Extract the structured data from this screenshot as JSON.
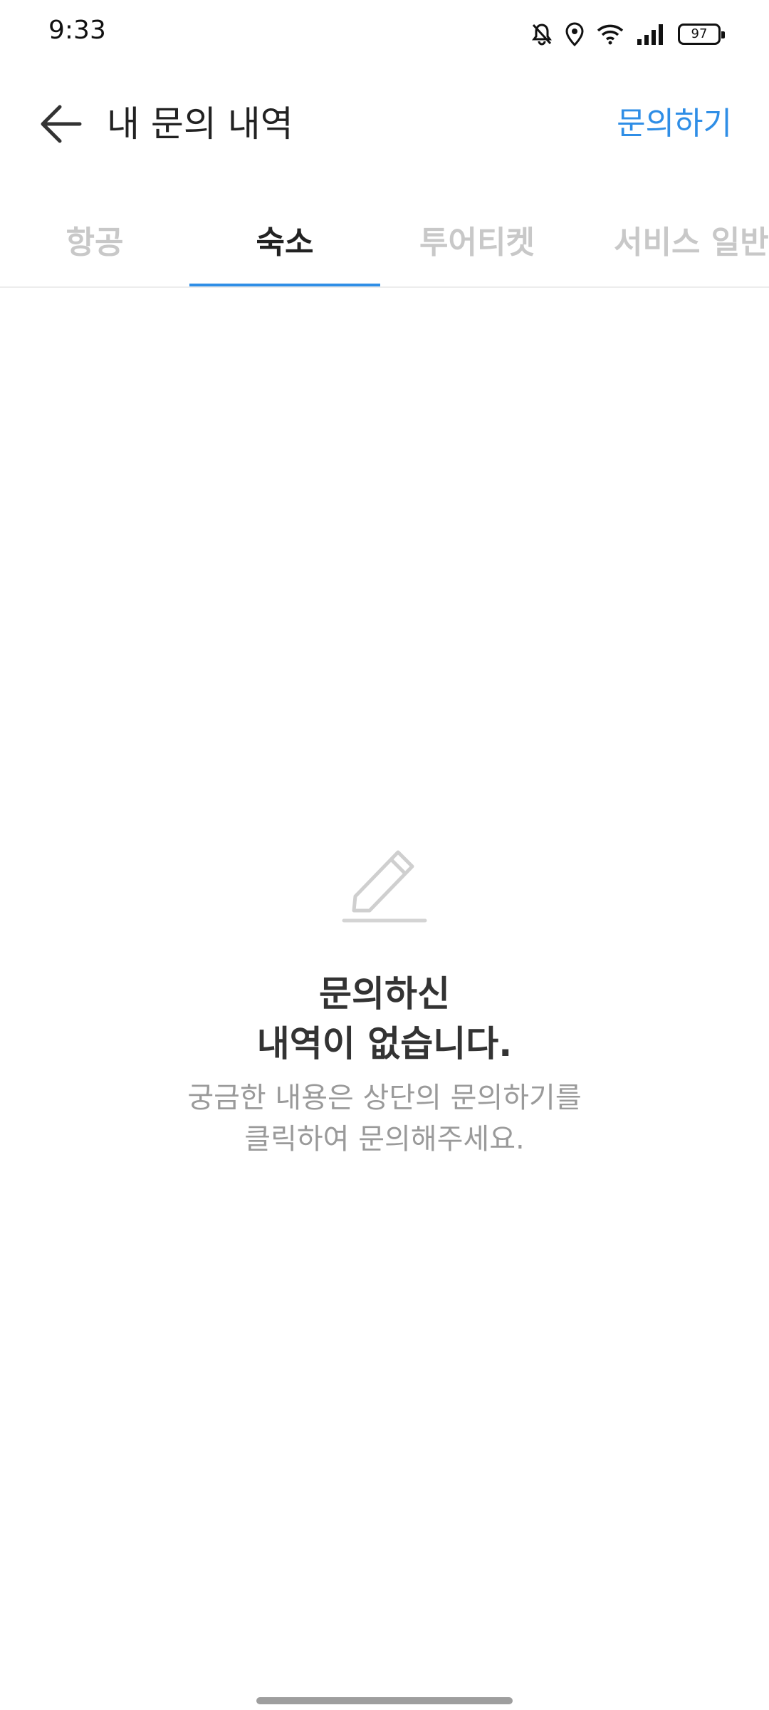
{
  "status_bar": {
    "time": "9:33",
    "battery": "97",
    "icons": [
      "mute-bell-icon",
      "location-icon",
      "wifi-icon",
      "signal-icon",
      "battery-icon"
    ]
  },
  "header": {
    "title": "내 문의 내역",
    "action_label": "문의하기",
    "back_icon": "arrow-left-icon"
  },
  "tabs": [
    {
      "label": "항공",
      "active": false
    },
    {
      "label": "숙소",
      "active": true
    },
    {
      "label": "투어티켓",
      "active": false
    },
    {
      "label": "서비스 일반",
      "active": false
    }
  ],
  "empty_state": {
    "icon": "pencil-icon",
    "title_line1": "문의하신",
    "title_line2": "내역이 없습니다.",
    "desc_line1": "궁금한 내용은 상단의 문의하기를",
    "desc_line2": "클릭하여 문의해주세요."
  },
  "colors": {
    "accent": "#2f8ee6",
    "inactive_tab": "#c8c8c8",
    "text_primary": "#222222",
    "text_secondary": "#9a9a9a"
  }
}
